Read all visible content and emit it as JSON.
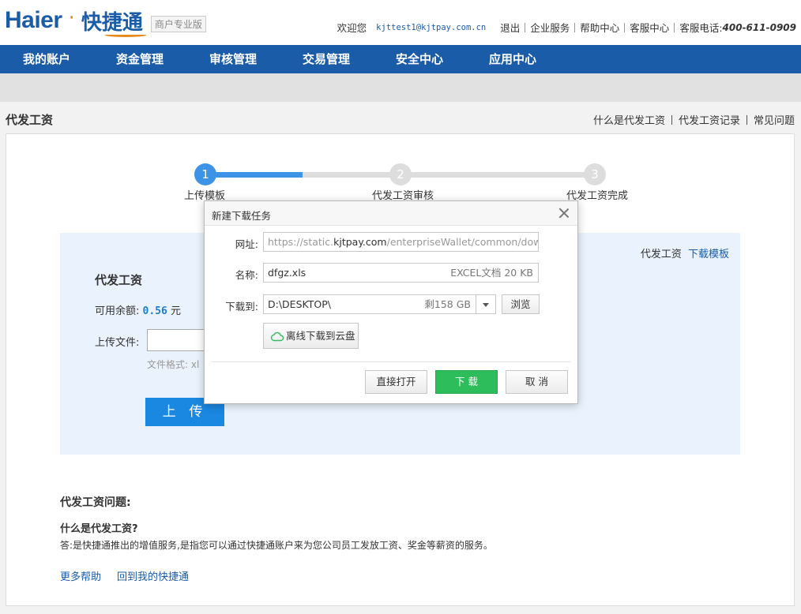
{
  "header": {
    "logo_brand": "Haier",
    "logo_sep": "·",
    "logo_product": "快捷通",
    "logo_badge": "商户专业版",
    "welcome": "欢迎您",
    "email": "kjttest1@kjtpay.com.cn",
    "links": [
      "退出",
      "企业服务",
      "帮助中心",
      "客服中心"
    ],
    "phone_label": "客服电话:",
    "phone": "400-611-0909"
  },
  "nav": {
    "items": [
      "我的账户",
      "资金管理",
      "审核管理",
      "交易管理",
      "安全中心",
      "应用中心"
    ]
  },
  "page": {
    "title": "代发工资",
    "right_links": [
      "什么是代发工资",
      "代发工资记录",
      "常见问题"
    ]
  },
  "steps": {
    "items": [
      {
        "num": "1",
        "label": "上传模板",
        "state": "active"
      },
      {
        "num": "2",
        "label": "代发工资审核",
        "state": "todo"
      },
      {
        "num": "3",
        "label": "代发工资完成",
        "state": "todo"
      }
    ],
    "progress_fraction": 0.25
  },
  "panel": {
    "link_text": "代发工资",
    "link_action": "下载模板",
    "title": "代发工资",
    "balance_label": "可用余额:",
    "balance_value": "0.56",
    "balance_unit": "元",
    "upload_label": "上传文件:",
    "format_hint": "文件格式: xl",
    "upload_button": "上 传"
  },
  "faq": {
    "title": "代发工资问题:",
    "question": "什么是代发工资?",
    "answer": "答:是快捷通推出的增值服务,是指您可以通过快捷通账户来为您公司员工发放工资、奖金等薪资的服务。",
    "links": [
      "更多帮助",
      "回到我的快捷通"
    ]
  },
  "dialog": {
    "title": "新建下载任务",
    "url_label": "网址:",
    "url_prefix": "https://static.",
    "url_domain": "kjtpay.com",
    "url_suffix": "/enterpriseWallet/common/downlc",
    "name_label": "名称:",
    "name_value": "dfgz.xls",
    "name_meta": "EXCEL文档 20 KB",
    "path_label": "下载到:",
    "path_value": "D:\\DESKTOP\\",
    "path_meta": "剩158 GB",
    "browse_button": "浏览",
    "cloud_button": "离线下载到云盘",
    "open_button": "直接打开",
    "download_button": "下 载",
    "cancel_button": "取 消"
  },
  "colors": {
    "brand_blue": "#1a5ca8",
    "accent_orange": "#e88a1a",
    "step_active": "#3d93e6",
    "download_green": "#2ebd5b"
  }
}
